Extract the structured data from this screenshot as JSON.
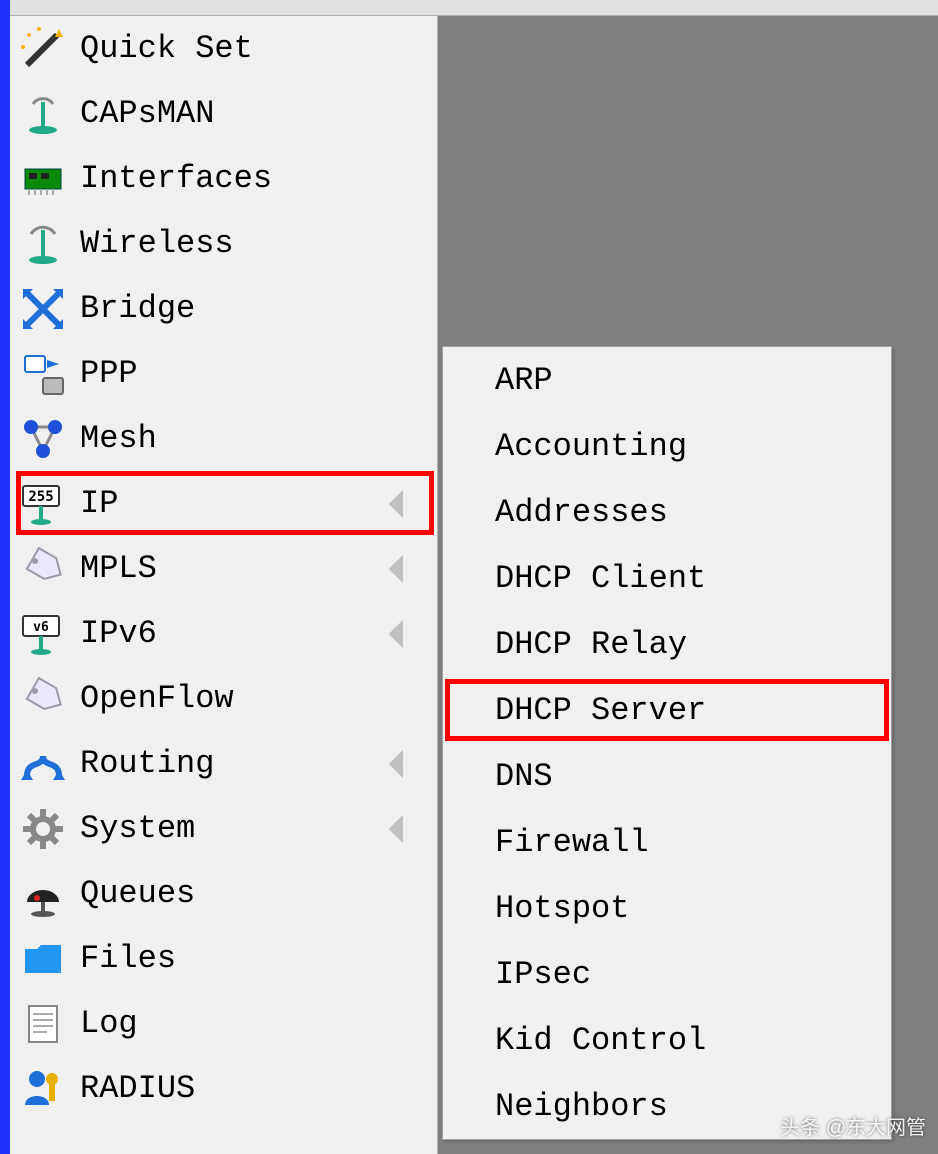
{
  "sidebar": {
    "items": [
      {
        "id": "quick-set",
        "label": "Quick Set",
        "icon": "wand-icon",
        "has_submenu": false
      },
      {
        "id": "capsman",
        "label": "CAPsMAN",
        "icon": "antenna-icon",
        "has_submenu": false
      },
      {
        "id": "interfaces",
        "label": "Interfaces",
        "icon": "chip-icon",
        "has_submenu": false
      },
      {
        "id": "wireless",
        "label": "Wireless",
        "icon": "antenna-icon",
        "has_submenu": false
      },
      {
        "id": "bridge",
        "label": "Bridge",
        "icon": "bridge-icon",
        "has_submenu": false
      },
      {
        "id": "ppp",
        "label": "PPP",
        "icon": "ppp-icon",
        "has_submenu": false
      },
      {
        "id": "mesh",
        "label": "Mesh",
        "icon": "mesh-icon",
        "has_submenu": false
      },
      {
        "id": "ip",
        "label": "IP",
        "icon": "ip255-icon",
        "has_submenu": true,
        "highlighted": true
      },
      {
        "id": "mpls",
        "label": "MPLS",
        "icon": "tag-icon",
        "has_submenu": true
      },
      {
        "id": "ipv6",
        "label": "IPv6",
        "icon": "ipv6-icon",
        "has_submenu": true
      },
      {
        "id": "openflow",
        "label": "OpenFlow",
        "icon": "tag-icon",
        "has_submenu": false
      },
      {
        "id": "routing",
        "label": "Routing",
        "icon": "routing-icon",
        "has_submenu": true
      },
      {
        "id": "system",
        "label": "System",
        "icon": "gear-icon",
        "has_submenu": true
      },
      {
        "id": "queues",
        "label": "Queues",
        "icon": "queues-icon",
        "has_submenu": false
      },
      {
        "id": "files",
        "label": "Files",
        "icon": "folder-icon",
        "has_submenu": false
      },
      {
        "id": "log",
        "label": "Log",
        "icon": "log-icon",
        "has_submenu": false
      },
      {
        "id": "radius",
        "label": "RADIUS",
        "icon": "radius-icon",
        "has_submenu": false
      }
    ]
  },
  "submenu": {
    "parent": "ip",
    "items": [
      {
        "id": "arp",
        "label": "ARP"
      },
      {
        "id": "accounting",
        "label": "Accounting"
      },
      {
        "id": "addresses",
        "label": "Addresses"
      },
      {
        "id": "dhcp-client",
        "label": "DHCP Client"
      },
      {
        "id": "dhcp-relay",
        "label": "DHCP Relay"
      },
      {
        "id": "dhcp-server",
        "label": "DHCP Server",
        "highlighted": true
      },
      {
        "id": "dns",
        "label": "DNS"
      },
      {
        "id": "firewall",
        "label": "Firewall"
      },
      {
        "id": "hotspot",
        "label": "Hotspot"
      },
      {
        "id": "ipsec",
        "label": "IPsec"
      },
      {
        "id": "kid-control",
        "label": "Kid Control"
      },
      {
        "id": "neighbors",
        "label": "Neighbors"
      }
    ]
  },
  "watermark": "头条 @东大网管"
}
